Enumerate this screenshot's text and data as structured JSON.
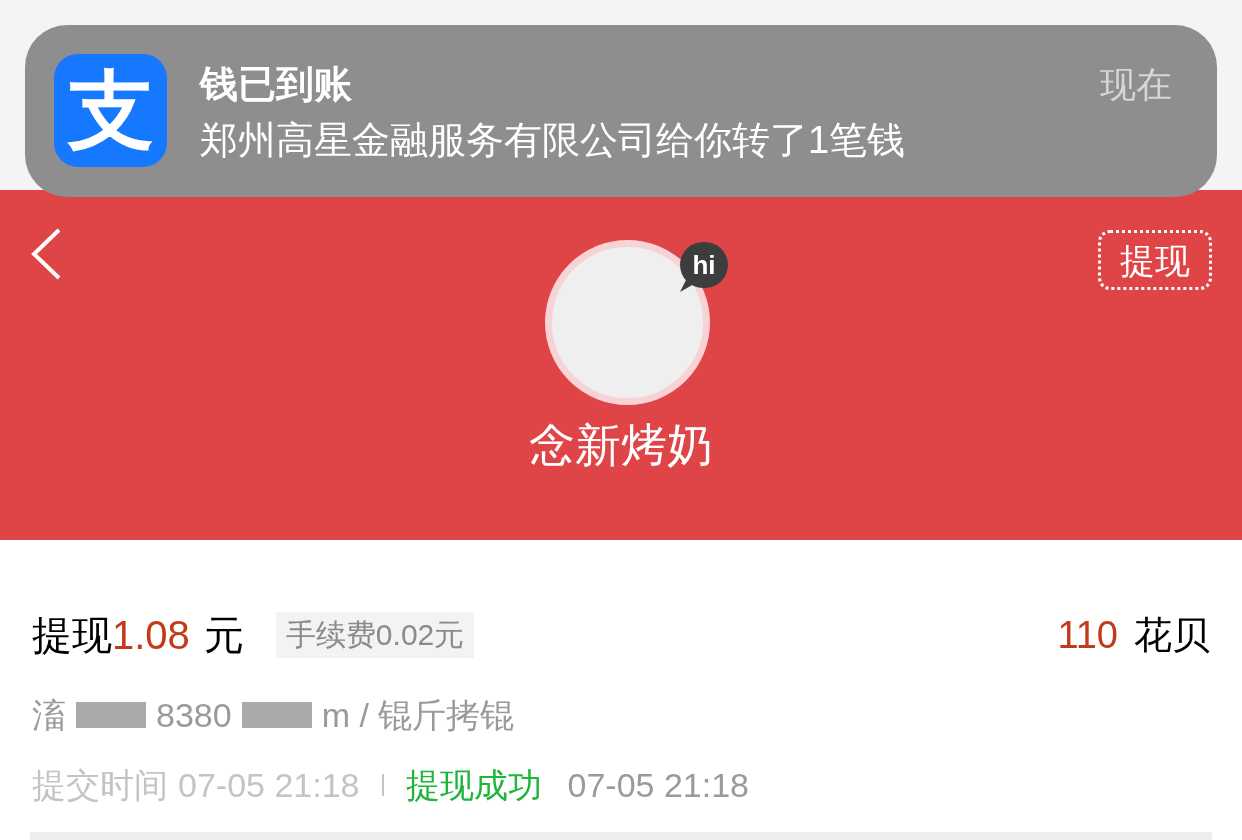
{
  "notification": {
    "app_icon_glyph": "支",
    "title": "钱已到账",
    "body": "郑州高星金融服务有限公司给你转了1笔钱",
    "time": "现在"
  },
  "header": {
    "withdraw_button": "提现",
    "avatar_badge": "hi",
    "name": "念新烤奶"
  },
  "record": {
    "label": "提现",
    "amount": "1.08",
    "unit": "元",
    "fee": "手续费0.02元",
    "points_value": "110",
    "points_unit": "花贝",
    "account_parts": [
      "滀",
      "8380",
      "m / 锟斤拷锟"
    ],
    "submit_label": "提交时间",
    "submit_time": "07-05 21:18",
    "status": "提现成功",
    "status_time": "07-05 21:18"
  }
}
